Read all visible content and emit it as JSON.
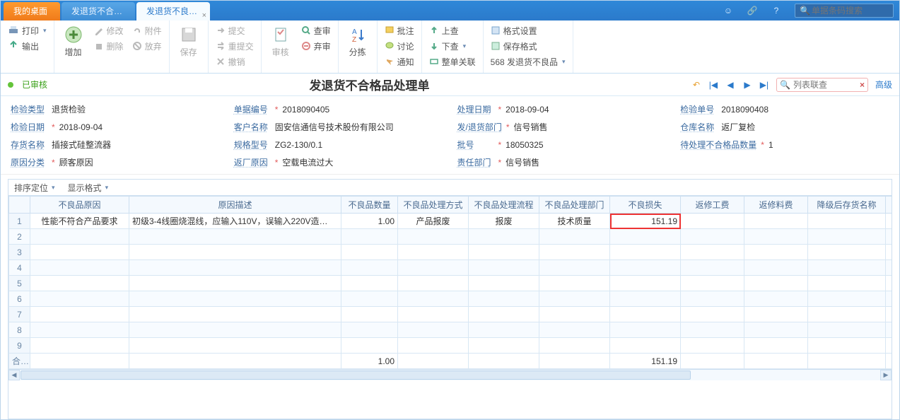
{
  "tabs": {
    "home": "我的桌面",
    "t1": "发退货不合…",
    "t2": "发退货不良…"
  },
  "search_placeholder": "单据条码搜索",
  "ribbon": {
    "print": "打印",
    "export": "输出",
    "add": "增加",
    "modify": "修改",
    "attach": "附件",
    "delete": "删除",
    "discard": "放弃",
    "save": "保存",
    "submit": "提交",
    "resubmit": "重提交",
    "cancel": "撤销",
    "audit": "审核",
    "query": "查审",
    "abandon": "弃审",
    "sort": "分拣",
    "batch": "批注",
    "discuss": "讨论",
    "notify": "通知",
    "up": "上查",
    "down": "下查",
    "relate": "整单关联",
    "fmtset": "格式设置",
    "savefmt": "保存格式",
    "badqty": "568 发退货不良品"
  },
  "status": "已审核",
  "doctitle": "发退货不合格品处理单",
  "listsearch_placeholder": "列表联查",
  "adv": "高级",
  "form": {
    "l_type": "检验类型",
    "v_type": "退货检验",
    "l_docno": "单据编号",
    "v_docno": "2018090405",
    "l_procdate": "处理日期",
    "v_procdate": "2018-09-04",
    "l_inspno": "检验单号",
    "v_inspno": "2018090408",
    "l_inspdate": "检验日期",
    "v_inspdate": "2018-09-04",
    "l_cust": "客户名称",
    "v_cust": "固安信通信号技术股份有限公司",
    "l_dept": "发/退货部门",
    "v_dept": "信号销售",
    "l_wh": "仓库名称",
    "v_wh": "返厂复检",
    "l_stock": "存货名称",
    "v_stock": "插接式硅整流器",
    "l_spec": "规格型号",
    "v_spec": "ZG2-130/0.1",
    "l_batch": "批号",
    "v_batch": "18050325",
    "l_pending": "待处理不合格品数量",
    "v_pending": "1",
    "l_causecat": "原因分类",
    "v_causecat": "顾客原因",
    "l_retcause": "返厂原因",
    "v_retcause": "空载电流过大",
    "l_resp": "责任部门",
    "v_resp": "信号销售"
  },
  "toolbar": {
    "sort": "排序定位",
    "disp": "显示格式"
  },
  "cols": [
    "",
    "不良品原因",
    "原因描述",
    "不良品数量",
    "不良品处理方式",
    "不良品处理流程",
    "不良品处理部门",
    "不良损失",
    "返修工费",
    "返修料费",
    "降级后存货名称",
    "降"
  ],
  "row": {
    "cause": "性能不符合产品要求",
    "desc": "初级3-4线圈烧混线，应输入110V，误输入220V造…",
    "qty": "1.00",
    "method": "产品报废",
    "flow": "报废",
    "pdept": "技术质量",
    "loss": "151.19"
  },
  "total_label": "合计",
  "total_qty": "1.00",
  "total_loss": "151.19"
}
